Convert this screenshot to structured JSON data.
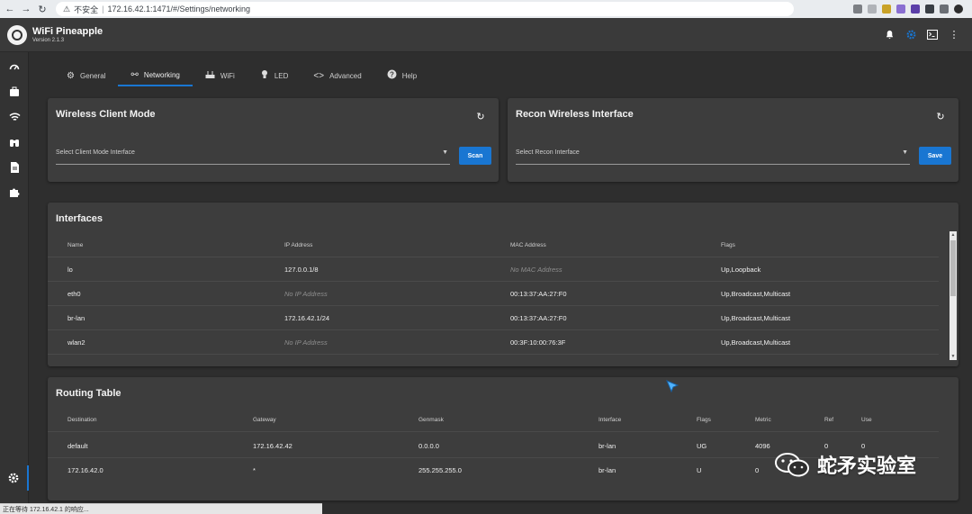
{
  "browser": {
    "security": "不安全",
    "url": "172.16.42.1:1471/#/Settings/networking"
  },
  "app": {
    "title": "WiFi Pineapple",
    "version": "Version 2.1.3"
  },
  "tabs": [
    {
      "label": "General",
      "icon": "gear-icon"
    },
    {
      "label": "Networking",
      "icon": "network-icon"
    },
    {
      "label": "WiFi",
      "icon": "router-icon"
    },
    {
      "label": "LED",
      "icon": "lightbulb-icon"
    },
    {
      "label": "Advanced",
      "icon": "code-icon"
    },
    {
      "label": "Help",
      "icon": "help-icon"
    }
  ],
  "client_mode": {
    "title": "Wireless Client Mode",
    "select_label": "Select Client Mode Interface",
    "button": "Scan"
  },
  "recon": {
    "title": "Recon Wireless Interface",
    "select_label": "Select Recon Interface",
    "button": "Save"
  },
  "interfaces": {
    "title": "Interfaces",
    "columns": [
      "Name",
      "IP Address",
      "MAC Address",
      "Flags"
    ],
    "rows": [
      [
        "lo",
        "127.0.0.1/8",
        "No MAC Address",
        "Up,Loopback"
      ],
      [
        "eth0",
        "No IP Address",
        "00:13:37:AA:27:F0",
        "Up,Broadcast,Multicast"
      ],
      [
        "br-lan",
        "172.16.42.1/24",
        "00:13:37:AA:27:F0",
        "Up,Broadcast,Multicast"
      ],
      [
        "wlan2",
        "No IP Address",
        "00:3F:10:00:76:3F",
        "Up,Broadcast,Multicast"
      ]
    ]
  },
  "routing": {
    "title": "Routing Table",
    "columns": [
      "Destination",
      "Gateway",
      "Genmask",
      "Interface",
      "Flags",
      "Metric",
      "Ref",
      "Use"
    ],
    "rows": [
      [
        "default",
        "172.16.42.42",
        "0.0.0.0",
        "br-lan",
        "UG",
        "4096",
        "0",
        "0"
      ],
      [
        "172.16.42.0",
        "*",
        "255.255.255.0",
        "br-lan",
        "U",
        "0",
        "",
        ""
      ]
    ]
  },
  "status_bar": "正在等待 172.16.42.1 的响应...",
  "watermark": "蛇矛实验室",
  "colors": {
    "accent": "#1976d2",
    "card": "#3d3d3d",
    "background": "#2e2e2e"
  }
}
